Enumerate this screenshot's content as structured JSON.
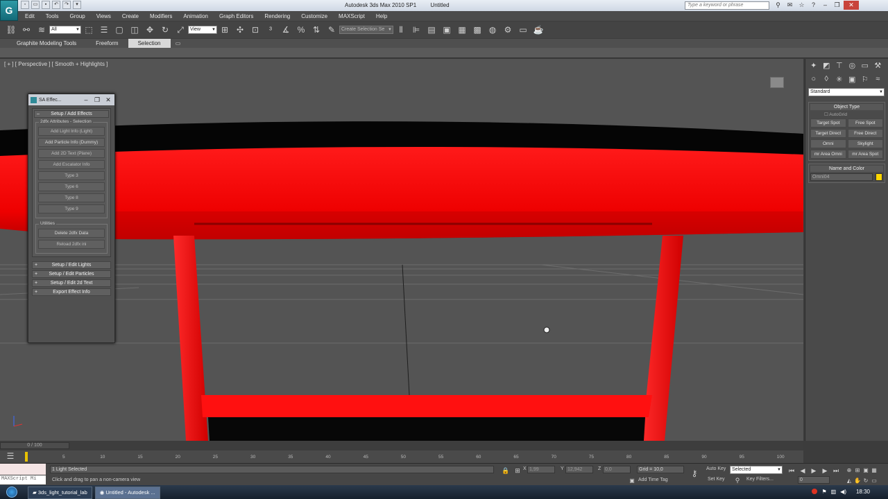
{
  "window": {
    "app_title": "Autodesk 3ds Max  2010 SP1",
    "doc_title": "Untitled",
    "search_placeholder": "Type a keyword or phrase"
  },
  "menu": [
    "Edit",
    "Tools",
    "Group",
    "Views",
    "Create",
    "Modifiers",
    "Animation",
    "Graph Editors",
    "Rendering",
    "Customize",
    "MAXScript",
    "Help"
  ],
  "toolbar": {
    "filter_value": "All",
    "refcoord_value": "View",
    "selset_value": "Create Selection Se"
  },
  "ribbon": {
    "tabs": [
      "Graphite Modeling Tools",
      "Freeform",
      "Selection"
    ]
  },
  "viewport": {
    "label": "[ + ] [ Perspective ] [ Smooth + Highlights ]"
  },
  "sa_panel": {
    "title": "SA Effec...",
    "rollout_main": "Setup / Add Effects",
    "group_attrs": "2dfx Attributes - Selection",
    "attr_buttons": [
      "Add Light Info (Light)",
      "Add Particle Info (Dummy)",
      "Add 2D Text (Plane)",
      "Add Escalator Info",
      "Type 3",
      "Type 6",
      "Type 8",
      "Type 9"
    ],
    "group_utils": "Utilities",
    "util_buttons": [
      "Delete 2dfx Data",
      "Reload 2dfx ini"
    ],
    "rollouts": [
      "Setup / Edit Lights",
      "Setup / Edit Particles",
      "Setup / Edit 2d Text",
      "Export Effect Info"
    ]
  },
  "command_panel": {
    "category": "Standard",
    "object_type_header": "Object Type",
    "autogrid": "AutoGrid",
    "object_buttons": [
      "Target Spot",
      "Free Spot",
      "Target Direct",
      "Free Direct",
      "Omni",
      "Skylight",
      "mr Area Omni",
      "mr Area Spot"
    ],
    "name_color_header": "Name and Color",
    "object_name": "Omni04",
    "object_color": "#ffd700"
  },
  "timeline": {
    "frame_counter": "0 / 100",
    "ticks": [
      "5",
      "10",
      "15",
      "20",
      "25",
      "30",
      "35",
      "40",
      "45",
      "50",
      "55",
      "60",
      "65",
      "70",
      "75",
      "80",
      "85",
      "90",
      "95",
      "100"
    ]
  },
  "status": {
    "maxscript": "MAXScript Mi",
    "selection": "1 Light Selected",
    "prompt": "Click and drag to pan a non-camera view",
    "x_label": "X",
    "x_value": "1,99",
    "y_label": "Y",
    "y_value": "12,942",
    "z_label": "Z",
    "z_value": "0,0",
    "grid": "Grid = 10,0",
    "add_time_tag": "Add Time Tag",
    "auto_key": "Auto Key",
    "set_key": "Set Key",
    "key_mode_value": "Selected",
    "key_filters": "Key Filters...",
    "frame_value": "0"
  },
  "taskbar": {
    "items": [
      "3ds_light_tutorial_lab",
      "Untitled - Autodesk ..."
    ],
    "time": "18:30"
  }
}
